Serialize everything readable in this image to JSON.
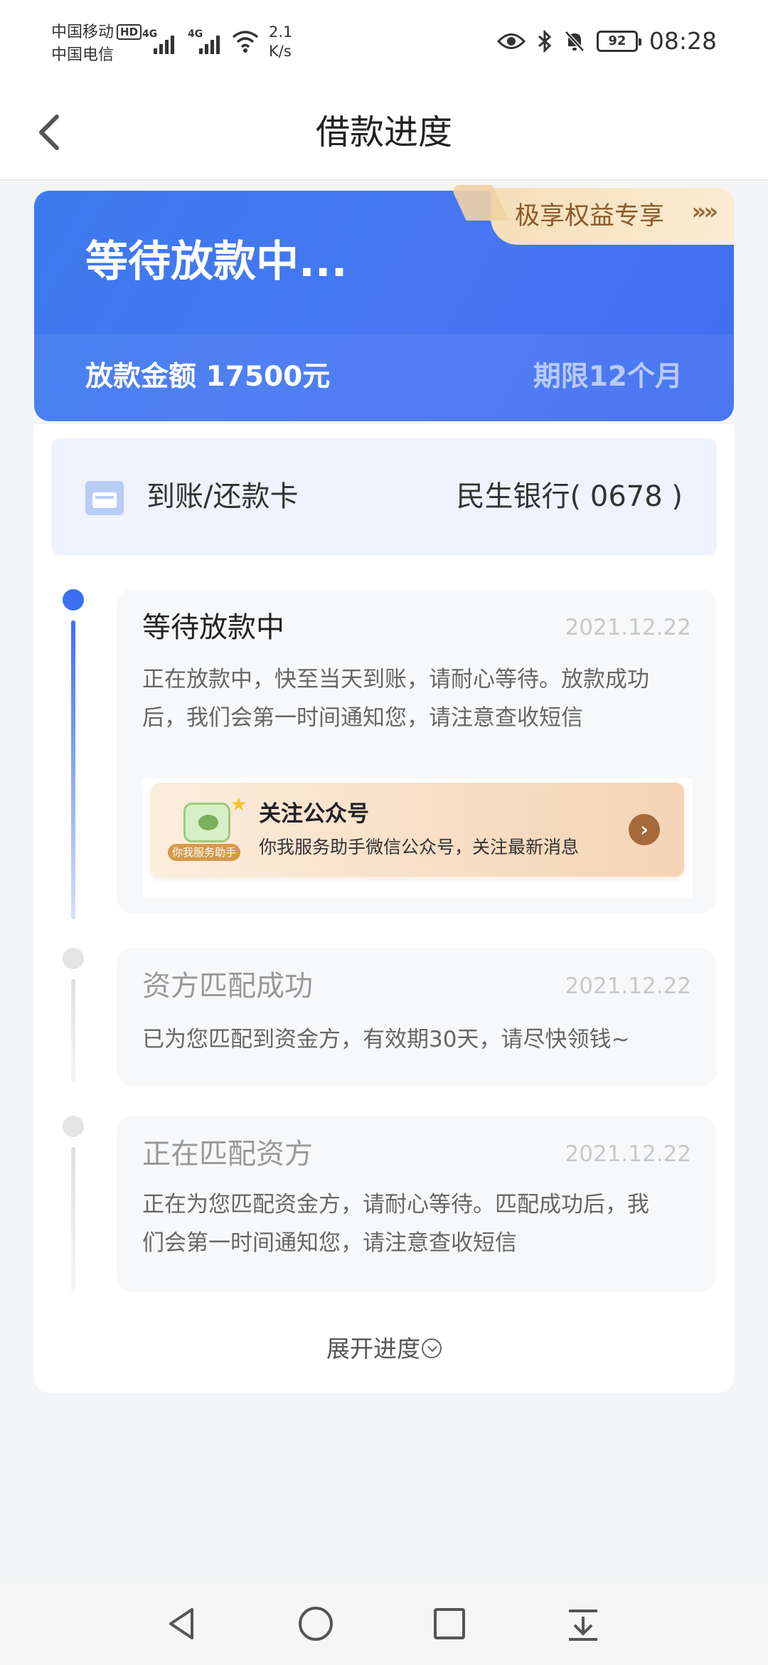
{
  "status_bar": {
    "carrier1": "中国移动",
    "hd_badge": "HD",
    "carrier2": "中国电信",
    "network1": "4G",
    "network2": "4G",
    "speed_value": "2.1",
    "speed_unit": "K/s",
    "battery": "92",
    "time": "08:28",
    "icons": [
      "eye-icon",
      "bluetooth-icon",
      "bell-muted-icon"
    ]
  },
  "header": {
    "title": "借款进度",
    "back_icon": "chevron-left-icon"
  },
  "loan_card": {
    "status": "等待放款中...",
    "perks_label": "极享权益专享",
    "perks_arrows": "»»",
    "amount_label": "放款金额 17500元",
    "term_label": "期限12个月",
    "accent_color": "#4776f2"
  },
  "bank": {
    "label": "到账/还款卡",
    "value": "民生银行( 0678 )"
  },
  "steps": [
    {
      "title": "等待放款中",
      "date": "2021.12.22",
      "desc_line1": "正在放款中，快至当天到账，请耐心等待。放款成功",
      "desc_line2": "后，我们会第一时间通知您，请注意查收短信",
      "active": true
    },
    {
      "title": "资方匹配成功",
      "date": "2021.12.22",
      "desc_line1": "已为您匹配到资金方，有效期30天，请尽快领钱~",
      "active": false
    },
    {
      "title": "正在匹配资方",
      "date": "2021.12.22",
      "desc_line1": "正在为您匹配资金方，请耐心等待。匹配成功后，我",
      "desc_line2": "们会第一时间通知您，请注意查收短信",
      "active": false
    }
  ],
  "follow_banner": {
    "icon_tag": "你我服务助手",
    "title": "关注公众号",
    "subtitle": "你我服务助手微信公众号，关注最新消息"
  },
  "expand_label": "展开进度"
}
